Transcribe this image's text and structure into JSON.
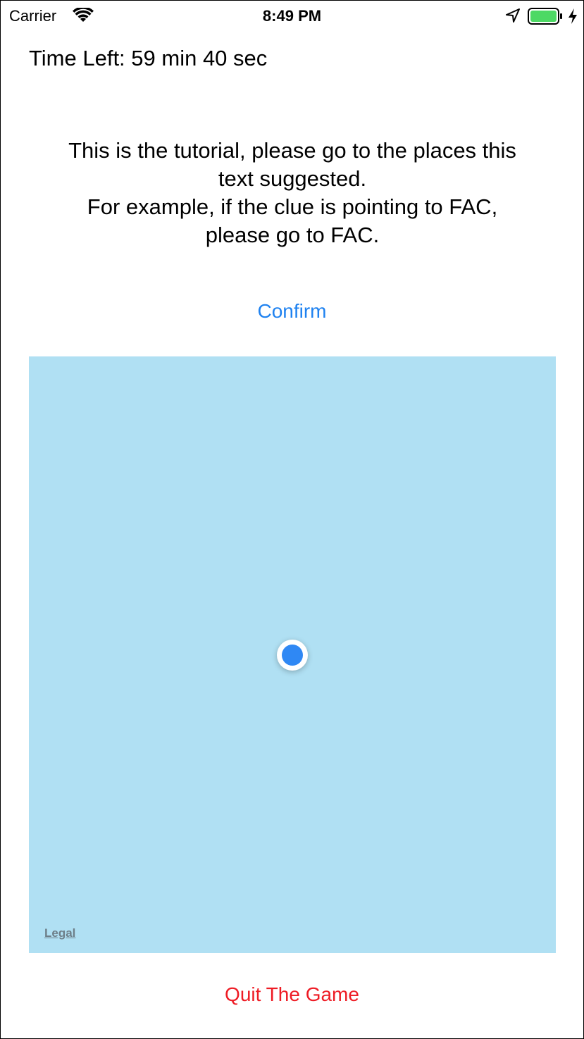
{
  "status_bar": {
    "carrier": "Carrier",
    "time": "8:49 PM",
    "battery_color": "#4cd964"
  },
  "timer": {
    "text": "Time Left: 59 min 40 sec"
  },
  "tutorial": {
    "lines": [
      "This is the tutorial, please go to the places this",
      "text suggested.",
      "For example, if the clue is pointing to FAC,",
      "please go to FAC."
    ]
  },
  "actions": {
    "confirm_label": "Confirm",
    "confirm_color": "#1f82f0",
    "quit_label": "Quit The Game",
    "quit_color": "#ee1c25"
  },
  "map": {
    "background_color": "#b0e0f3",
    "legal_label": "Legal",
    "user_location_color": "#2f88f4"
  }
}
